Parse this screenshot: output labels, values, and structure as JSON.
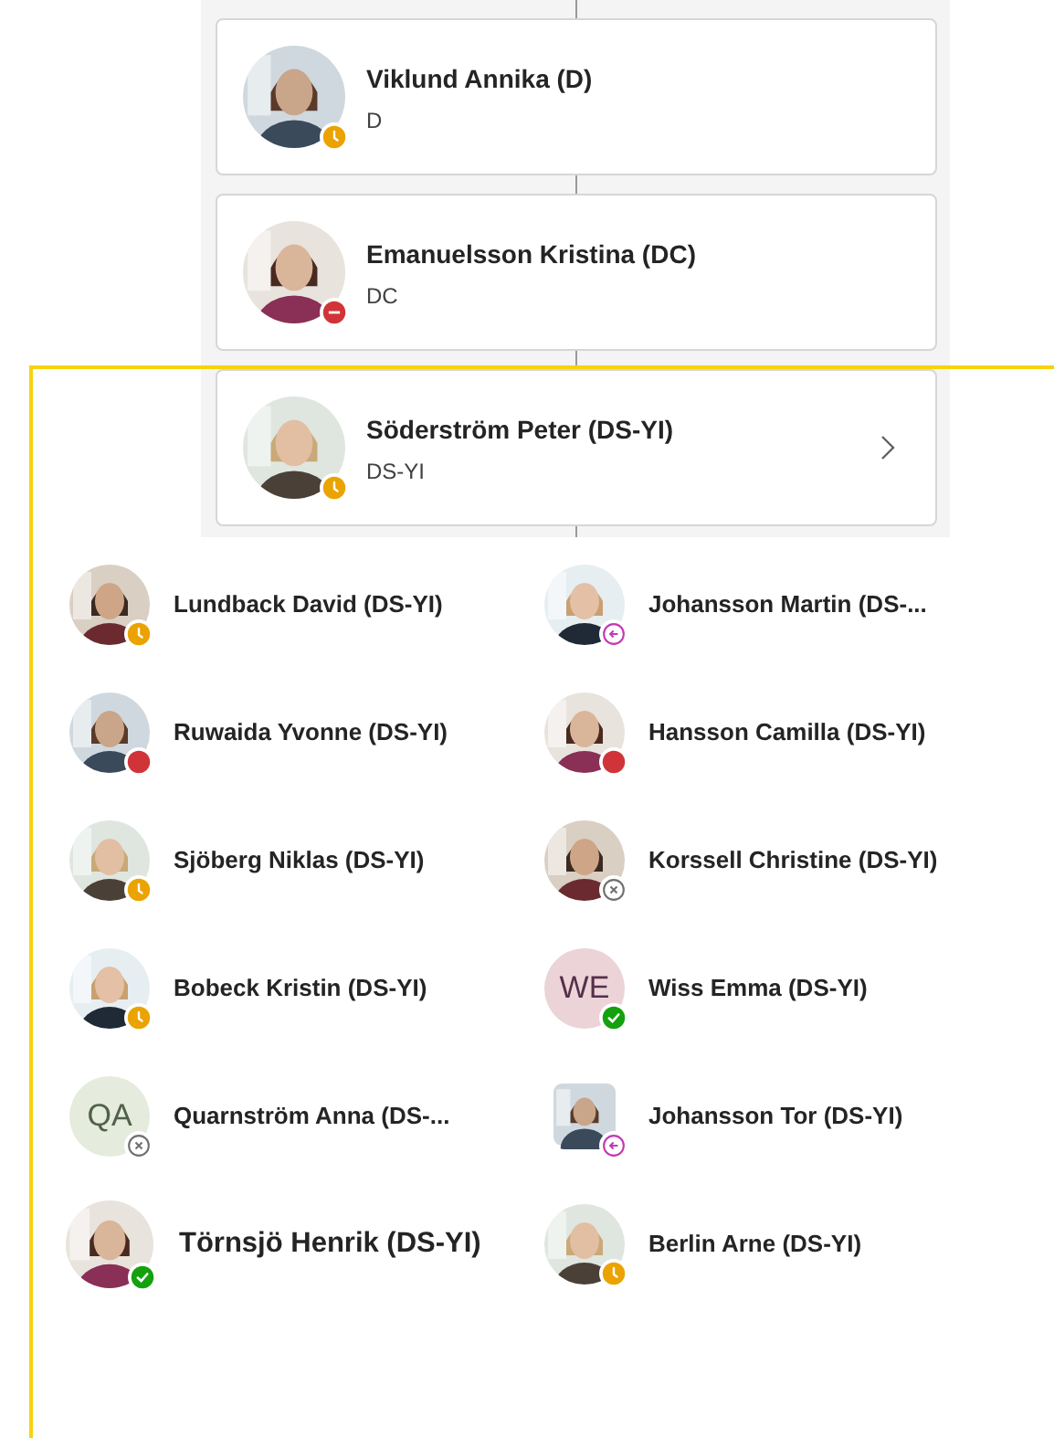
{
  "chain": [
    {
      "name": "Viklund Annika (D)",
      "title": "D",
      "presence": {
        "kind": "away"
      },
      "expandable": false
    },
    {
      "name": "Emanuelsson Kristina (DC)",
      "title": "DC",
      "presence": {
        "kind": "dnd"
      },
      "expandable": false
    },
    {
      "name": "Söderström Peter (DS-YI)",
      "title": "DS-YI",
      "presence": {
        "kind": "away"
      },
      "expandable": true
    }
  ],
  "reports": [
    {
      "name": "Lundback David (DS-YI)",
      "presence": {
        "kind": "away"
      },
      "large": false
    },
    {
      "name": "Johansson Martin (DS-...",
      "presence": {
        "kind": "oof"
      },
      "large": false
    },
    {
      "name": "Ruwaida Yvonne (DS-YI)",
      "presence": {
        "kind": "busy"
      },
      "large": false
    },
    {
      "name": "Hansson Camilla (DS-YI)",
      "presence": {
        "kind": "busy"
      },
      "large": false
    },
    {
      "name": "Sjöberg Niklas (DS-YI)",
      "presence": {
        "kind": "away"
      },
      "large": false
    },
    {
      "name": "Korssell Christine (DS-YI)",
      "presence": {
        "kind": "offline"
      },
      "large": false
    },
    {
      "name": "Bobeck Kristin (DS-YI)",
      "presence": {
        "kind": "away"
      },
      "large": false
    },
    {
      "name": "Wiss Emma (DS-YI)",
      "presence": {
        "kind": "available"
      },
      "avatar": {
        "kind": "initials",
        "initials": "WE",
        "color": "#ecd3d8"
      },
      "large": false
    },
    {
      "name": "Quarnström Anna (DS-...",
      "presence": {
        "kind": "offline"
      },
      "avatar": {
        "kind": "initials",
        "initials": "QA",
        "color": "#e5ebdd"
      },
      "large": false
    },
    {
      "name": "Johansson Tor (DS-YI)",
      "presence": {
        "kind": "oof"
      },
      "avatar": {
        "kind": "photo_square"
      },
      "large": false
    },
    {
      "name": "Törnsjö Henrik (DS-YI)",
      "presence": {
        "kind": "available"
      },
      "large": true
    },
    {
      "name": "Berlin Arne (DS-YI)",
      "presence": {
        "kind": "away"
      },
      "large": false
    }
  ]
}
